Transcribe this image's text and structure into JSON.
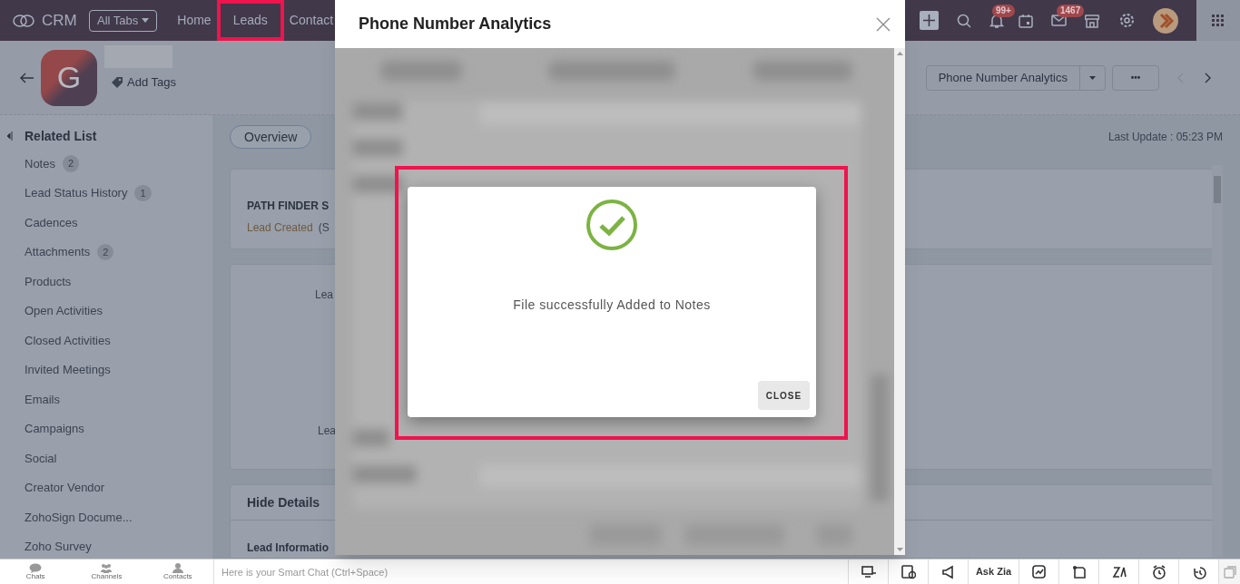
{
  "top_nav": {
    "logo": "CRM",
    "all_tabs": "All Tabs",
    "tabs": [
      {
        "label": "Home",
        "highlighted": false
      },
      {
        "label": "Leads",
        "highlighted": true
      },
      {
        "label": "Contact",
        "highlighted": false
      }
    ],
    "notification_badge": "99+",
    "mail_badge": "1467"
  },
  "record_header": {
    "avatar_letter": "G",
    "add_tags": "Add Tags",
    "action_button": "Phone Number Analytics",
    "more_button": "•••"
  },
  "sidebar": {
    "title": "Related List",
    "items": [
      {
        "label": "Notes",
        "count": "2"
      },
      {
        "label": "Lead Status History",
        "count": "1"
      },
      {
        "label": "Cadences"
      },
      {
        "label": "Attachments",
        "count": "2"
      },
      {
        "label": "Products"
      },
      {
        "label": "Open Activities"
      },
      {
        "label": "Closed Activities"
      },
      {
        "label": "Invited Meetings"
      },
      {
        "label": "Emails"
      },
      {
        "label": "Campaigns"
      },
      {
        "label": "Social"
      },
      {
        "label": "Creator Vendor"
      },
      {
        "label": "ZohoSign Docume..."
      },
      {
        "label": "Zoho Survey"
      }
    ]
  },
  "content": {
    "overview_tab": "Overview",
    "last_update": "Last Update : 05:23 PM",
    "path_finder_title": "PATH FINDER S",
    "path_finder_status": "Lead Created",
    "path_finder_note": "(S",
    "field_label_1": "Lea",
    "field_label_2": "Lea",
    "hide_details": "Hide Details",
    "section_title": "Lead Informatio"
  },
  "dialog": {
    "title": "Phone Number Analytics",
    "popup": {
      "message": "File successfully Added to Notes",
      "button": "CLOSE",
      "highlighted": true
    }
  },
  "footer": {
    "tabs": [
      "Chats",
      "Channels",
      "Contacts"
    ],
    "chat_placeholder": "Here is your Smart Chat (Ctrl+Space)",
    "ask_zia": "Ask Zia"
  }
}
